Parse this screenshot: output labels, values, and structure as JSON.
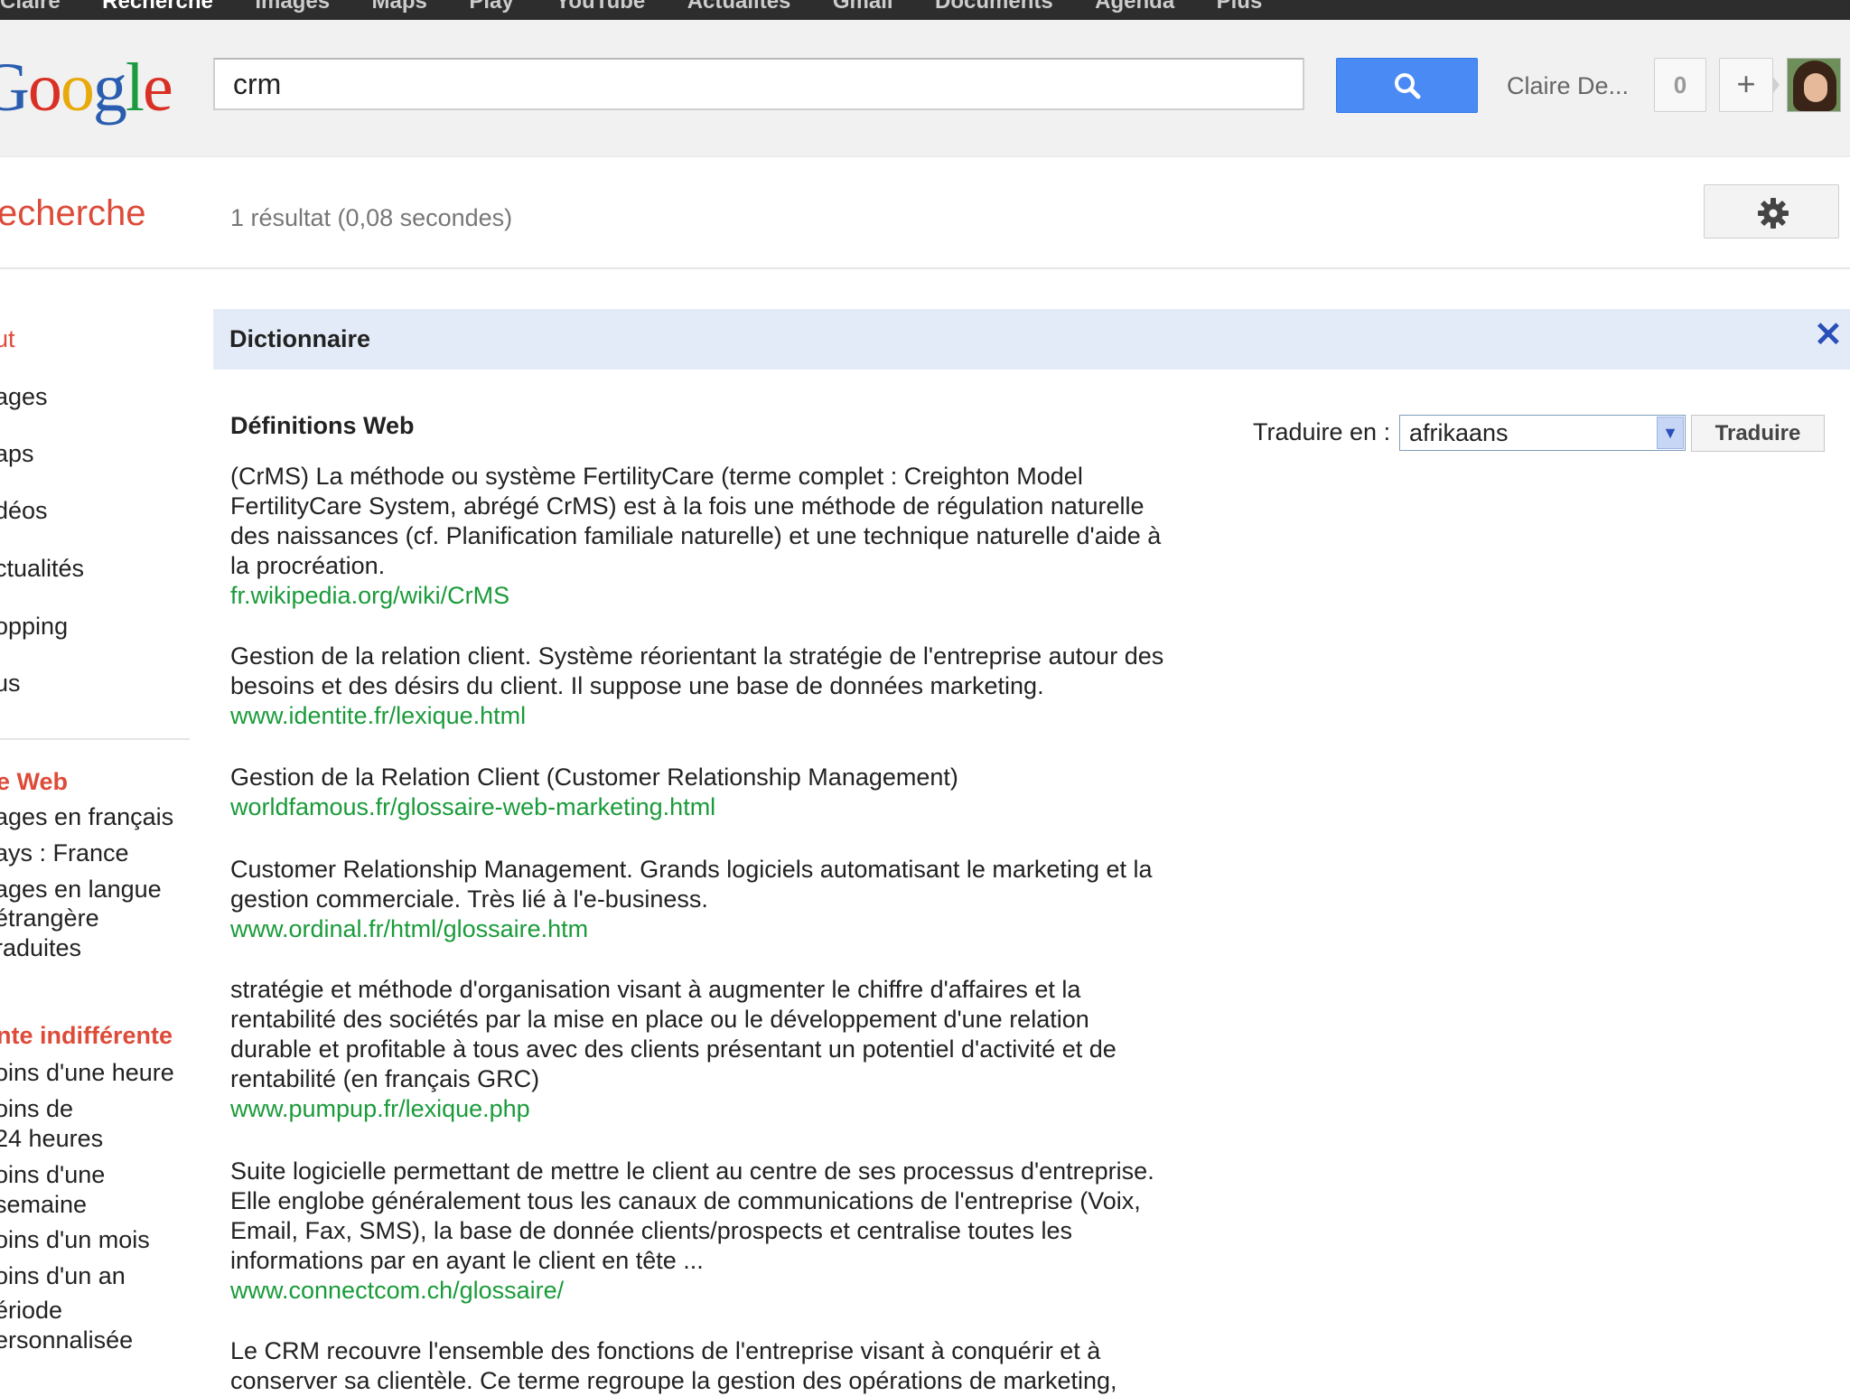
{
  "topbar": {
    "items": [
      "Claire",
      "Recherche",
      "Images",
      "Maps",
      "Play",
      "YouTube",
      "Actualités",
      "Gmail",
      "Documents",
      "Agenda",
      "Plus"
    ]
  },
  "header": {
    "logo": "Google",
    "search_value": "crm",
    "user_name": "Claire De...",
    "notification_count": "0",
    "share_label": "+"
  },
  "subheader": {
    "title": "echerche",
    "result_stats": "1 résultat (0,08 secondes)"
  },
  "leftnav": {
    "items": [
      "ut",
      "ages",
      "aps",
      "déos",
      "ctualités",
      "opping",
      "us"
    ],
    "web_heading": "e Web",
    "web_filters": [
      "ages en français",
      "ays : France",
      "ages en langue",
      "étrangère",
      "raduites"
    ],
    "date_heading": "nte indifférente",
    "date_filters": [
      "oins d'une heure",
      "oins de",
      "24 heures",
      "oins d'une",
      "semaine",
      "oins d'un mois",
      "oins d'un an",
      "ériode",
      "ersonnalisée"
    ]
  },
  "dictionary": {
    "title": "Dictionnaire",
    "close": "✕",
    "definitions_title": "Définitions Web",
    "translate_label": "Traduire en :",
    "language": "afrikaans",
    "translate_button": "Traduire",
    "definitions": [
      {
        "lines": [
          "(CrMS) La méthode ou système FertilityCare (terme complet : Creighton Model",
          "FertilityCare System, abrégé CrMS) est à la fois une méthode de régulation naturelle",
          "des naissances (cf. Planification familiale naturelle) et une technique naturelle d'aide à",
          "la procréation."
        ],
        "url": "fr.wikipedia.org/wiki/CrMS"
      },
      {
        "lines": [
          "Gestion de la relation client. Système réorientant la stratégie de l'entreprise autour des",
          "besoins et des désirs du client. Il suppose une base de données marketing."
        ],
        "url": "www.identite.fr/lexique.html"
      },
      {
        "lines": [
          "Gestion de la Relation Client (Customer Relationship Management)"
        ],
        "url": "worldfamous.fr/glossaire-web-marketing.html"
      },
      {
        "lines": [
          "Customer Relationship Management. Grands logiciels automatisant le marketing et la",
          "gestion commerciale. Très lié à l'e-business."
        ],
        "url": "www.ordinal.fr/html/glossaire.htm"
      },
      {
        "lines": [
          "stratégie et méthode d'organisation visant à augmenter le chiffre d'affaires et la",
          "rentabilité des sociétés par la mise en place ou le développement d'une relation",
          "durable et profitable à tous avec des clients présentant un potentiel d'activité et de",
          "rentabilité (en français GRC)"
        ],
        "url": "www.pumpup.fr/lexique.php"
      },
      {
        "lines": [
          "Suite logicielle permettant de mettre le client au centre de ses processus d'entreprise.",
          "Elle englobe généralement tous les canaux de communications de l'entreprise (Voix,",
          "Email, Fax, SMS), la base de donnée clients/prospects et centralise toutes les",
          "informations par en ayant le client en tête ..."
        ],
        "url": "www.connectcom.ch/glossaire/"
      },
      {
        "lines": [
          "Le CRM recouvre l'ensemble des fonctions de l'entreprise visant à conquérir et à",
          "conserver sa clientèle. Ce terme regroupe la gestion des opérations de marketing,"
        ],
        "url": ""
      }
    ]
  },
  "colors": {
    "accent_red": "#dd4b39",
    "search_blue": "#4a8af4",
    "url_green": "#1a9b3a",
    "dict_bg": "#e4ebf8"
  }
}
